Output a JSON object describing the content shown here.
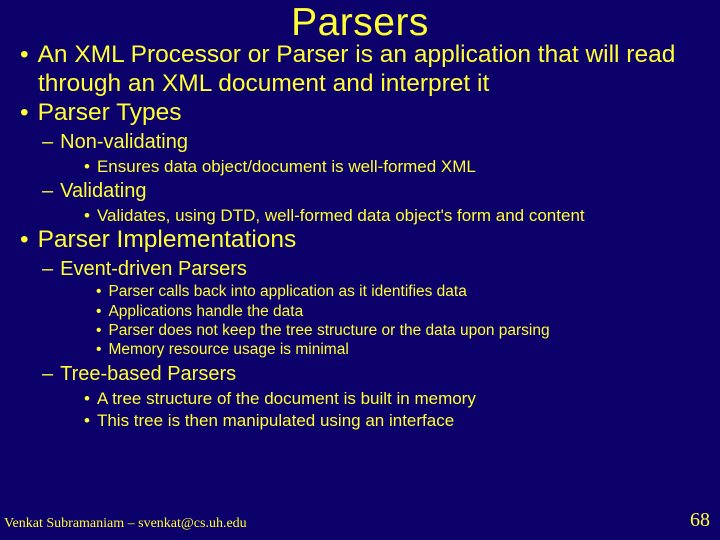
{
  "title": "Parsers",
  "bullets": {
    "b1": "An XML Processor or Parser is an application that will read through an XML document and interpret it",
    "b2": "Parser Types",
    "b2a": "Non-validating",
    "b2a1": "Ensures data object/document is well-formed XML",
    "b2b": "Validating",
    "b2b1": "Validates, using DTD, well-formed data object's form and content",
    "b3": "Parser Implementations",
    "b3a": "Event-driven Parsers",
    "b3a1": "Parser calls back into application as it identifies data",
    "b3a2": "Applications handle the data",
    "b3a3": "Parser does not keep the tree structure or the data upon parsing",
    "b3a4": "Memory resource usage is minimal",
    "b3b": "Tree-based Parsers",
    "b3b1": "A tree structure of the document is built in memory",
    "b3b2": "This tree is then manipulated using an interface"
  },
  "footer": {
    "author": "Venkat Subramaniam – svenkat@cs.uh.edu",
    "page": "68"
  }
}
